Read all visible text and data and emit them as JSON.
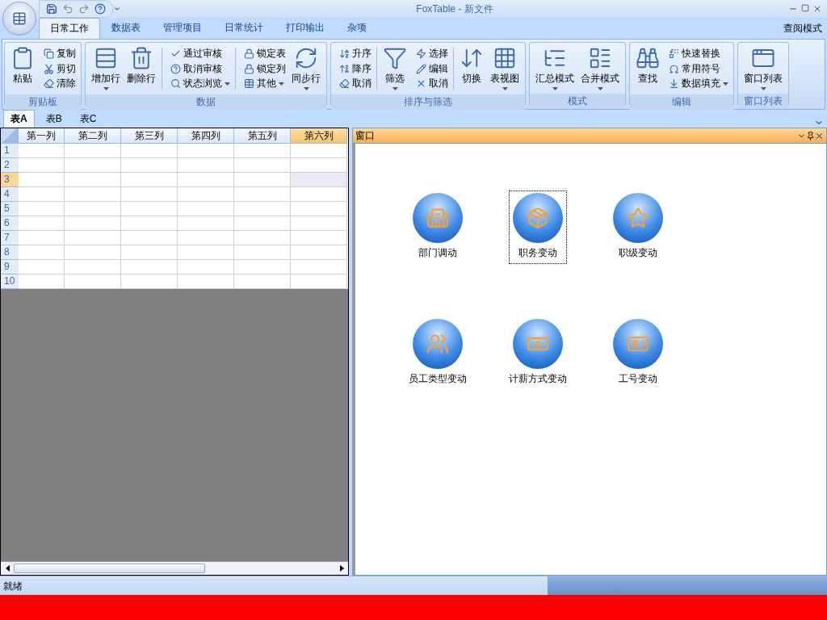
{
  "window": {
    "title": "FoxTable - 新文件"
  },
  "ribbon_tabs": [
    {
      "label": "日常工作",
      "selected": true
    },
    {
      "label": "数据表",
      "selected": false
    },
    {
      "label": "管理项目",
      "selected": false
    },
    {
      "label": "日常统计",
      "selected": false
    },
    {
      "label": "打印输出",
      "selected": false
    },
    {
      "label": "杂项",
      "selected": false
    }
  ],
  "ribbon_right_label": "查阅模式",
  "ribbon_groups": [
    {
      "label": "剪贴板",
      "columns": [
        {
          "kind": "large",
          "label": "粘贴",
          "dropdown": false
        },
        {
          "kind": "stack",
          "items": [
            {
              "label": "复制",
              "dropdown": false
            },
            {
              "label": "剪切",
              "dropdown": false
            },
            {
              "label": "清除",
              "dropdown": false
            }
          ]
        }
      ]
    },
    {
      "label": "数据",
      "columns": [
        {
          "kind": "large",
          "label": "增加行",
          "dropdown": true
        },
        {
          "kind": "large",
          "label": "删除行",
          "dropdown": false
        },
        {
          "kind": "separator"
        },
        {
          "kind": "stack",
          "items": [
            {
              "label": "通过审核",
              "dropdown": false
            },
            {
              "label": "取消审核",
              "dropdown": false
            },
            {
              "label": "状态浏览",
              "dropdown": true
            }
          ]
        },
        {
          "kind": "separator"
        },
        {
          "kind": "stack",
          "items": [
            {
              "label": "锁定表",
              "dropdown": false
            },
            {
              "label": "锁定列",
              "dropdown": false
            },
            {
              "label": "其他",
              "dropdown": true
            }
          ]
        },
        {
          "kind": "large",
          "label": "同步行",
          "dropdown": true
        }
      ]
    },
    {
      "label": "排序与筛选",
      "columns": [
        {
          "kind": "stack",
          "items": [
            {
              "label": "升序",
              "dropdown": false
            },
            {
              "label": "降序",
              "dropdown": false
            },
            {
              "label": "取消",
              "dropdown": false
            }
          ]
        },
        {
          "kind": "separator"
        },
        {
          "kind": "large",
          "label": "筛选",
          "dropdown": true
        },
        {
          "kind": "stack",
          "items": [
            {
              "label": "选择",
              "dropdown": false
            },
            {
              "label": "编辑",
              "dropdown": false
            },
            {
              "label": "取消",
              "dropdown": false
            }
          ]
        },
        {
          "kind": "separator"
        },
        {
          "kind": "large",
          "label": "切换",
          "dropdown": false
        },
        {
          "kind": "large",
          "label": "表视图",
          "dropdown": true
        }
      ]
    },
    {
      "label": "模式",
      "columns": [
        {
          "kind": "large",
          "label": "汇总模式",
          "dropdown": true
        },
        {
          "kind": "large",
          "label": "合并模式",
          "dropdown": true
        }
      ]
    },
    {
      "label": "编辑",
      "columns": [
        {
          "kind": "large",
          "label": "查找",
          "dropdown": false
        },
        {
          "kind": "stack",
          "items": [
            {
              "label": "快速替换",
              "dropdown": false
            },
            {
              "label": "常用符号",
              "dropdown": false
            },
            {
              "label": "数据填充",
              "dropdown": true
            }
          ]
        }
      ]
    },
    {
      "label": "窗口列表",
      "columns": [
        {
          "kind": "large",
          "label": "窗口列表",
          "dropdown": true
        }
      ]
    }
  ],
  "sheet_tabs": [
    {
      "label": "表A",
      "selected": true
    },
    {
      "label": "表B",
      "selected": false
    },
    {
      "label": "表C",
      "selected": false
    }
  ],
  "table": {
    "columns": [
      {
        "label": "第一列",
        "selected": false
      },
      {
        "label": "第二列",
        "selected": false
      },
      {
        "label": "第三列",
        "selected": false
      },
      {
        "label": "第四列",
        "selected": false
      },
      {
        "label": "第五列",
        "selected": false
      },
      {
        "label": "第六列",
        "selected": true
      }
    ],
    "rows": [
      {
        "label": "1",
        "selected": false
      },
      {
        "label": "2",
        "selected": false
      },
      {
        "label": "3",
        "selected": true
      },
      {
        "label": "4",
        "selected": false
      },
      {
        "label": "5",
        "selected": false
      },
      {
        "label": "6",
        "selected": false
      },
      {
        "label": "7",
        "selected": false
      },
      {
        "label": "8",
        "selected": false
      },
      {
        "label": "9",
        "selected": false
      },
      {
        "label": "10",
        "selected": false
      }
    ]
  },
  "panel": {
    "title": "窗口",
    "items": [
      {
        "label": "部门调动",
        "selected": false
      },
      {
        "label": "职务变动",
        "selected": true
      },
      {
        "label": "职级变动",
        "selected": false
      },
      {
        "label": "员工类型变动",
        "selected": false
      },
      {
        "label": "计薪方式变动",
        "selected": false
      },
      {
        "label": "工号变动",
        "selected": false
      }
    ]
  },
  "status_bar": {
    "text": "就绪"
  }
}
